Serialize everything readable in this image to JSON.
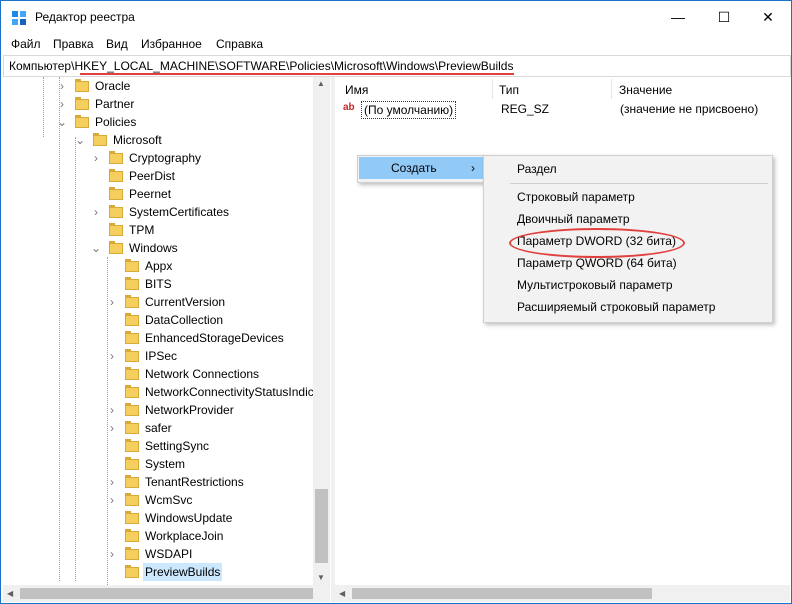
{
  "window": {
    "title": "Редактор реестра"
  },
  "menu": [
    "Файл",
    "Правка",
    "Вид",
    "Избранное",
    "Справка"
  ],
  "address": "Компьютер\\HKEY_LOCAL_MACHINE\\SOFTWARE\\Policies\\Microsoft\\Windows\\PreviewBuilds",
  "tree": {
    "items": [
      {
        "label": "Oracle",
        "expander": ">"
      },
      {
        "label": "Partner",
        "expander": ">"
      },
      {
        "label": "Policies",
        "expander": "v"
      },
      {
        "label": "Microsoft",
        "expander": "v"
      },
      {
        "label": "Cryptography",
        "expander": ">"
      },
      {
        "label": "PeerDist",
        "expander": ""
      },
      {
        "label": "Peernet",
        "expander": ""
      },
      {
        "label": "SystemCertificates",
        "expander": ">"
      },
      {
        "label": "TPM",
        "expander": ""
      },
      {
        "label": "Windows",
        "expander": "v"
      },
      {
        "label": "Appx",
        "expander": ""
      },
      {
        "label": "BITS",
        "expander": ""
      },
      {
        "label": "CurrentVersion",
        "expander": ">"
      },
      {
        "label": "DataCollection",
        "expander": ""
      },
      {
        "label": "EnhancedStorageDevices",
        "expander": ""
      },
      {
        "label": "IPSec",
        "expander": ">"
      },
      {
        "label": "Network Connections",
        "expander": ""
      },
      {
        "label": "NetworkConnectivityStatusIndica",
        "expander": ""
      },
      {
        "label": "NetworkProvider",
        "expander": ">"
      },
      {
        "label": "safer",
        "expander": ">"
      },
      {
        "label": "SettingSync",
        "expander": ""
      },
      {
        "label": "System",
        "expander": ""
      },
      {
        "label": "TenantRestrictions",
        "expander": ">"
      },
      {
        "label": "WcmSvc",
        "expander": ">"
      },
      {
        "label": "WindowsUpdate",
        "expander": ""
      },
      {
        "label": "WorkplaceJoin",
        "expander": ""
      },
      {
        "label": "WSDAPI",
        "expander": ">"
      },
      {
        "label": "PreviewBuilds",
        "expander": "",
        "selected": true
      }
    ]
  },
  "list": {
    "headers": {
      "name": "Имя",
      "type": "Тип",
      "value": "Значение"
    },
    "rows": [
      {
        "icon": "ab",
        "name": "(По умолчанию)",
        "type": "REG_SZ",
        "value": "(значение не присвоено)"
      }
    ]
  },
  "context_menu": {
    "label": "Создать",
    "arrow": "›"
  },
  "submenu": {
    "items": [
      "Раздел",
      "Строковый параметр",
      "Двоичный параметр",
      "Параметр DWORD (32 бита)",
      "Параметр QWORD (64 бита)",
      "Мультистроковый параметр",
      "Расширяемый строковый параметр"
    ]
  },
  "caption": {
    "minimize": "—",
    "maximize": "☐",
    "close": "✕"
  },
  "colors": {
    "accent": "#1a73c9",
    "highlight": "#e0413e",
    "selection": "#cce8ff"
  }
}
